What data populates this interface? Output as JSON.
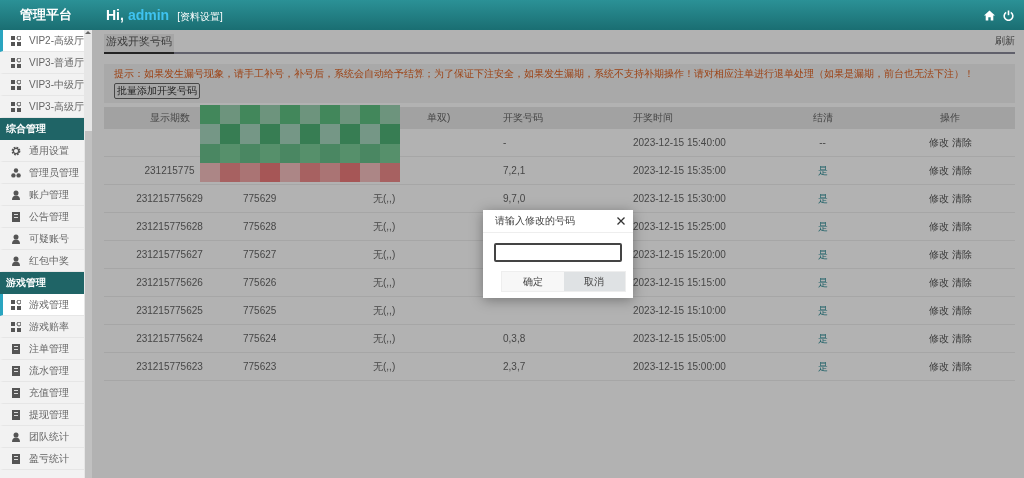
{
  "header": {
    "title": "管理平台",
    "greeting": "Hi,",
    "user": "admin",
    "profile_link": "[资料设置]"
  },
  "sidebar": {
    "items": [
      {
        "kind": "grid",
        "label": "VIP2-高级厅",
        "selected": true
      },
      {
        "kind": "grid",
        "label": "VIP3-普通厅",
        "selected": false
      },
      {
        "kind": "grid",
        "label": "VIP3-中级厅",
        "selected": false
      },
      {
        "kind": "grid",
        "label": "VIP3-高级厅",
        "selected": false
      },
      {
        "kind": "section",
        "label": "综合管理"
      },
      {
        "kind": "gear",
        "label": "通用设置",
        "selected": false
      },
      {
        "kind": "group",
        "label": "管理员管理",
        "selected": false
      },
      {
        "kind": "person",
        "label": "账户管理",
        "selected": false
      },
      {
        "kind": "doc",
        "label": "公告管理",
        "selected": false
      },
      {
        "kind": "person",
        "label": "可疑账号",
        "selected": false
      },
      {
        "kind": "person",
        "label": "红包中奖",
        "selected": false
      },
      {
        "kind": "section",
        "label": "游戏管理"
      },
      {
        "kind": "grid",
        "label": "游戏管理",
        "selected": true
      },
      {
        "kind": "grid",
        "label": "游戏赔率",
        "selected": false
      },
      {
        "kind": "doc",
        "label": "注单管理",
        "selected": false
      },
      {
        "kind": "doc",
        "label": "流水管理",
        "selected": false
      },
      {
        "kind": "doc",
        "label": "充值管理",
        "selected": false
      },
      {
        "kind": "doc",
        "label": "提现管理",
        "selected": false
      },
      {
        "kind": "person",
        "label": "团队统计",
        "selected": false
      },
      {
        "kind": "doc",
        "label": "盈亏统计",
        "selected": false
      }
    ]
  },
  "tabs": [
    {
      "label": "游戏开奖号码",
      "selected": true
    }
  ],
  "refresh": "刷新",
  "notice": "提示：如果发生漏号现象，请手工补号，补号后，系统会自动给予结算；为了保证下注安全，如果发生漏期，系统不支持补期操作！请对相应注单进行退单处理（如果是漏期，前台也无法下注）！",
  "batch_button": "批量添加开奖号码",
  "table": {
    "header": {
      "period": "显示期数",
      "column_3": "单双)",
      "numbers": "开奖号码",
      "time": "开奖时间",
      "settled": "结清",
      "actions": "操作"
    },
    "rows": [
      {
        "numbers": "-",
        "time": "2023-12-15 15:40:00",
        "settled": "--",
        "settled_link": false,
        "actions": [
          "修改",
          "清除"
        ]
      },
      {
        "period": "231215775",
        "numbers": "7,2,1",
        "time": "2023-12-15 15:35:00",
        "settled": "是",
        "settled_link": true,
        "actions": [
          "修改",
          "清除"
        ]
      },
      {
        "period": "231215775629",
        "column_2": "775629",
        "column_3": "无(,,)",
        "numbers": "9,7,0",
        "time": "2023-12-15 15:30:00",
        "settled": "是",
        "settled_link": true,
        "actions": [
          "修改",
          "清除"
        ]
      },
      {
        "period": "231215775628",
        "column_2": "775628",
        "column_3": "无(,,)",
        "time": "2023-12-15 15:25:00",
        "settled": "是",
        "settled_link": true,
        "actions": [
          "修改",
          "清除"
        ]
      },
      {
        "period": "231215775627",
        "column_2": "775627",
        "column_3": "无(,,)",
        "time": "2023-12-15 15:20:00",
        "settled": "是",
        "settled_link": true,
        "actions": [
          "修改",
          "清除"
        ]
      },
      {
        "period": "231215775626",
        "column_2": "775626",
        "column_3": "无(,,)",
        "time": "2023-12-15 15:15:00",
        "settled": "是",
        "settled_link": true,
        "actions": [
          "修改",
          "清除"
        ]
      },
      {
        "period": "231215775625",
        "column_2": "775625",
        "column_3": "无(,,)",
        "time": "2023-12-15 15:10:00",
        "settled": "是",
        "settled_link": true,
        "actions": [
          "修改",
          "清除"
        ]
      },
      {
        "period": "231215775624",
        "column_2": "775624",
        "column_3": "无(,,)",
        "numbers": "0,3,8",
        "time": "2023-12-15 15:05:00",
        "settled": "是",
        "settled_link": true,
        "actions": [
          "修改",
          "清除"
        ]
      },
      {
        "period": "231215775623",
        "column_2": "775623",
        "column_3": "无(,,)",
        "numbers": "2,3,7",
        "time": "2023-12-15 15:00:00",
        "settled": "是",
        "settled_link": true,
        "actions": [
          "修改",
          "清除"
        ]
      }
    ]
  },
  "dialog": {
    "title": "请输入修改的号码",
    "input_focused": true,
    "buttons": [
      {
        "label": "确定",
        "highlighted": false
      },
      {
        "label": "取消",
        "highlighted": true
      }
    ]
  }
}
